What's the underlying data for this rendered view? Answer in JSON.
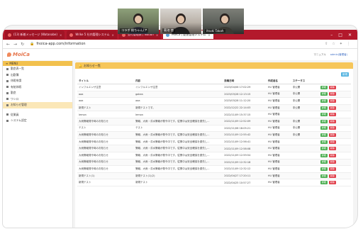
{
  "video": {
    "participants": [
      {
        "name": "コラボ 桃ちゃん(ア"
      },
      {
        "name": "菊池 悠"
      },
      {
        "name": "itsuki Takah"
      }
    ]
  },
  "browser": {
    "tabs": [
      {
        "label": "(13) 新着メッセージ (Watanabe)",
        "active": false
      },
      {
        "label": "Wrike 5 社内管理システム",
        "active": false
      },
      {
        "label": "受付管理表 | Notion",
        "active": false
      },
      {
        "label": "MoiCa | 勤退管理システム",
        "active": true
      }
    ],
    "url": "fnoica-app.com/information"
  },
  "app": {
    "logo": "MoiCa",
    "header_links": [
      "マニュアル",
      "admin(管理者)"
    ]
  },
  "sidebar": {
    "menu_label": "MENU",
    "items": [
      {
        "label": "勤怠表一覧",
        "active": false
      },
      {
        "label": "出勤簿",
        "active": false
      },
      {
        "label": "休暇申請",
        "active": false
      },
      {
        "label": "有給休暇",
        "active": false
      },
      {
        "label": "勤怠",
        "active": false
      },
      {
        "label": "ワシロ",
        "active": false
      },
      {
        "label": "お知らせ管理",
        "active": true
      }
    ],
    "items2": [
      {
        "label": "従業員"
      },
      {
        "label": "システム設定"
      }
    ]
  },
  "main": {
    "panel_title": "お知らせ一覧",
    "new_button": "新規",
    "columns": [
      "タイトル",
      "内容",
      "投稿日時",
      "作成者名",
      "ステータス",
      ""
    ],
    "detail_label": "詳細",
    "delete_label": "削除",
    "rows": [
      {
        "title": "インフルエンザ注意",
        "body": "インフルエンザ注意",
        "date": "2023/04/06 17:02:29",
        "author": "HU 管理者",
        "status": "非公開"
      },
      {
        "title": "aaa",
        "body": "gakea",
        "date": "2023/03/28 12:13:15",
        "author": "HU 管理者",
        "status": "非公開"
      },
      {
        "title": "aaa",
        "body": "aaa",
        "date": "2023/03/28 11:12:20",
        "author": "HU 管理者",
        "status": "非公開"
      },
      {
        "title": "新規テスト",
        "body": "新規テストです。",
        "date": "2022/12/22 22:14:03",
        "author": "HU 管理者",
        "status": "非公開"
      },
      {
        "title": "lemon",
        "body": "lemon",
        "date": "2022/11/09 15:37:15",
        "author": "HU 管理者",
        "status": ""
      },
      {
        "title": "大雨警報発令時のお知らせ",
        "body": "警報、大雨・洪水警報が発令中です。従業中は安全確保を優先し...",
        "date": "2022/11/09 12:52:09",
        "author": "HU 管理者",
        "status": "非公開"
      },
      {
        "title": "テスト",
        "body": "テスト",
        "date": "2022/11/08 18:05:21",
        "author": "HU 管理者",
        "status": "非公開"
      },
      {
        "title": "大雨警報発令時のお知らせ",
        "body": "警報、大雨・洪水警報が発令中です。従業中は安全確保を優先し...",
        "date": "2022/11/09 12:55:42",
        "author": "HU 管理者",
        "status": "非公開"
      },
      {
        "title": "大雨警報発令時のお知らせ",
        "body": "警報、大雨・洪水警報が発令中です。従業中は安全確保を優先し...",
        "date": "2022/11/09 12:56:41",
        "author": "HU 管理者",
        "status": ""
      },
      {
        "title": "大雨警報発令時のお知らせ",
        "body": "警報、大雨・洪水警報が発令中です。従業中は安全確保を優先し...",
        "date": "2022/11/09 12:58:08",
        "author": "HU 管理者",
        "status": ""
      },
      {
        "title": "大雨警報発令時のお知らせ",
        "body": "警報、大雨・洪水警報が発令中です。従業中は安全確保を優先し...",
        "date": "2022/11/09 12:59:54",
        "author": "HU 管理者",
        "status": ""
      },
      {
        "title": "大雨警報発令時のお知らせ",
        "body": "警報、大雨・洪水警報が発令中です。従業中は安全確保を優先し...",
        "date": "2022/11/09 12:32:18",
        "author": "HU 管理者",
        "status": ""
      },
      {
        "title": "大雨警報発令時のお知らせ",
        "body": "警報、大雨・洪水警報が発令中です。従業中は安全確保を優先し...",
        "date": "2022/11/09 12:32:12",
        "author": "HU 管理者",
        "status": ""
      },
      {
        "title": "新規テスト(1)",
        "body": "新規テスト(1)(2)",
        "date": "2022/04/27 17:20:11",
        "author": "HU 管理者",
        "status": ""
      },
      {
        "title": "新規テスト",
        "body": "新規テスト",
        "date": "2022/04/25 10:57:27",
        "author": "HU 管理者",
        "status": ""
      }
    ]
  },
  "colors": {
    "tabbar": "#b3192c",
    "menu_accent": "#f2c14e",
    "detail_button": "#4cae52",
    "delete_button": "#e0404c",
    "new_button": "#55b4e0"
  }
}
